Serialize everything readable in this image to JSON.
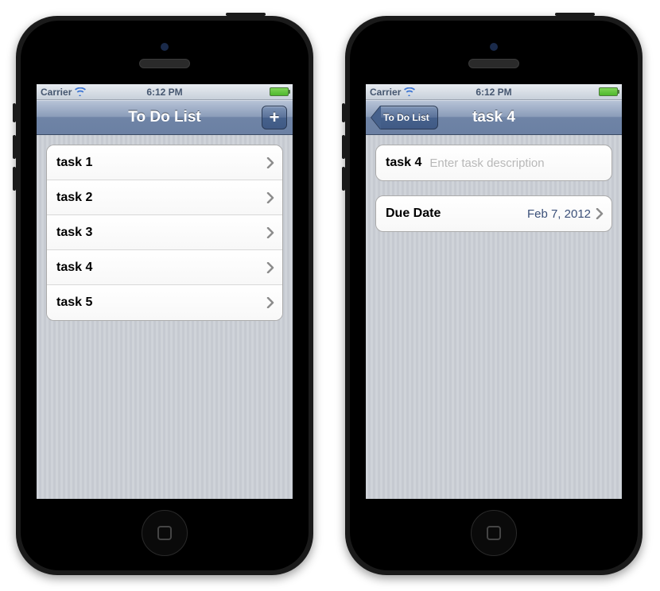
{
  "status": {
    "carrier": "Carrier",
    "time": "6:12 PM"
  },
  "list_screen": {
    "title": "To Do List",
    "add_label": "+",
    "tasks": [
      {
        "label": "task 1"
      },
      {
        "label": "task 2"
      },
      {
        "label": "task 3"
      },
      {
        "label": "task 4"
      },
      {
        "label": "task 5"
      }
    ]
  },
  "detail_screen": {
    "back_label": "To Do List",
    "title": "task 4",
    "task_name_label": "task 4",
    "description_placeholder": "Enter task description",
    "due_date_label": "Due Date",
    "due_date_value": "Feb 7, 2012"
  }
}
